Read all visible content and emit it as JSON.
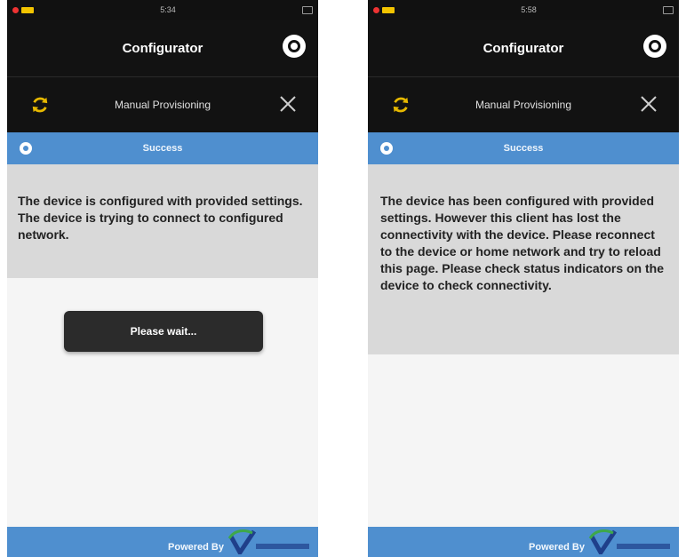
{
  "screens": [
    {
      "status_time": "5:34",
      "title": "Configurator",
      "toolbar_title": "Manual Provisioning",
      "banner": "Success",
      "message": "The device is configured with provided settings. The device is trying to connect to configured network.",
      "wait_button": "Please wait...",
      "footer": "Powered By"
    },
    {
      "status_time": "5:58",
      "title": "Configurator",
      "toolbar_title": "Manual Provisioning",
      "banner": "Success",
      "message": "The device has been configured with provided settings. However this client has lost the connectivity with the device. Please reconnect to the device or home network and try to reload this page. Please check status indicators on the device to check connectivity.",
      "footer": "Powered By"
    }
  ],
  "colors": {
    "header_bg": "#121212",
    "banner_blue": "#4f8fcf",
    "message_bg": "#d9d9d9",
    "button_bg": "#2b2b2b",
    "refresh_icon": "#e6b800"
  },
  "icons": [
    "gear-icon",
    "refresh-icon",
    "close-icon",
    "info-icon",
    "brand-logo"
  ]
}
